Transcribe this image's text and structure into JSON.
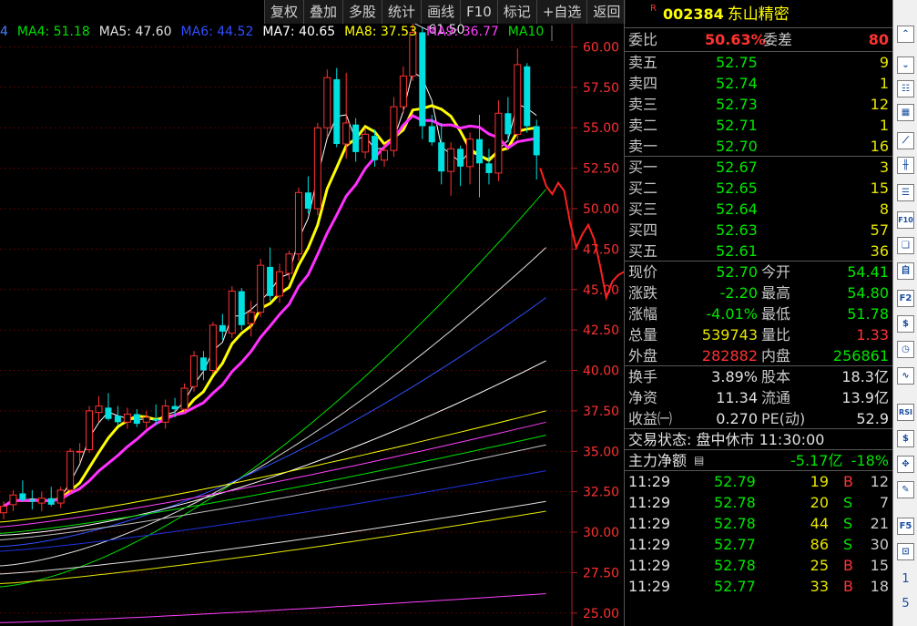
{
  "toolbar": [
    "复权",
    "叠加",
    "多股",
    "统计",
    "画线",
    "F10",
    "标记",
    "+自选",
    "返回"
  ],
  "ma_legend": [
    {
      "label": "4",
      "color": "#4080ff"
    },
    {
      "label": "MA4: 51.18",
      "color": "#00e000"
    },
    {
      "label": "MA5: 47.60",
      "color": "#e0e0e0"
    },
    {
      "label": "MA6: 44.52",
      "color": "#3050ff"
    },
    {
      "label": "MA7: 40.65",
      "color": "#ffffff"
    },
    {
      "label": "MA8: 37.53",
      "color": "#ffff00"
    },
    {
      "label": "MA9: 36.77",
      "color": "#ff40ff"
    },
    {
      "label": "MA10",
      "color": "#00e000"
    }
  ],
  "chart_data": {
    "type": "candlestick",
    "price_axis": [
      "60.00",
      "57.50",
      "55.00",
      "52.50",
      "50.00",
      "47.50",
      "45.00",
      "42.50",
      "40.00",
      "37.50",
      "35.00",
      "32.50",
      "30.00",
      "27.50",
      "25.00"
    ],
    "ylim": [
      24.2,
      62.9
    ],
    "high_annotation": "61.50",
    "candles": [
      {
        "o": 31.2,
        "h": 31.9,
        "l": 30.8,
        "c": 31.6
      },
      {
        "o": 31.7,
        "h": 32.6,
        "l": 31.3,
        "c": 32.3
      },
      {
        "o": 32.4,
        "h": 33.2,
        "l": 31.9,
        "c": 32.0
      },
      {
        "o": 32.0,
        "h": 32.6,
        "l": 31.4,
        "c": 31.9
      },
      {
        "o": 31.8,
        "h": 32.5,
        "l": 31.3,
        "c": 32.1
      },
      {
        "o": 32.1,
        "h": 32.8,
        "l": 31.6,
        "c": 31.7
      },
      {
        "o": 31.8,
        "h": 32.8,
        "l": 31.5,
        "c": 32.6
      },
      {
        "o": 32.6,
        "h": 35.2,
        "l": 32.4,
        "c": 35.0
      },
      {
        "o": 35.0,
        "h": 35.5,
        "l": 34.3,
        "c": 35.0
      },
      {
        "o": 35.1,
        "h": 37.8,
        "l": 34.9,
        "c": 37.5
      },
      {
        "o": 37.4,
        "h": 38.4,
        "l": 36.8,
        "c": 37.8
      },
      {
        "o": 37.7,
        "h": 38.6,
        "l": 36.9,
        "c": 37.0
      },
      {
        "o": 37.2,
        "h": 37.8,
        "l": 36.6,
        "c": 36.8
      },
      {
        "o": 36.8,
        "h": 37.7,
        "l": 36.4,
        "c": 37.3
      },
      {
        "o": 37.3,
        "h": 37.6,
        "l": 36.5,
        "c": 36.7
      },
      {
        "o": 36.8,
        "h": 37.5,
        "l": 36.4,
        "c": 37.1
      },
      {
        "o": 37.0,
        "h": 37.9,
        "l": 36.6,
        "c": 36.9
      },
      {
        "o": 36.8,
        "h": 38.2,
        "l": 36.4,
        "c": 37.8
      },
      {
        "o": 37.8,
        "h": 38.3,
        "l": 37.1,
        "c": 37.6
      },
      {
        "o": 37.6,
        "h": 39.2,
        "l": 37.4,
        "c": 38.9
      },
      {
        "o": 39.0,
        "h": 41.2,
        "l": 38.7,
        "c": 40.9
      },
      {
        "o": 40.8,
        "h": 41.2,
        "l": 39.4,
        "c": 40.0
      },
      {
        "o": 40.0,
        "h": 43.0,
        "l": 39.8,
        "c": 42.8
      },
      {
        "o": 42.8,
        "h": 43.5,
        "l": 41.9,
        "c": 42.4
      },
      {
        "o": 42.3,
        "h": 45.2,
        "l": 42.0,
        "c": 44.9
      },
      {
        "o": 44.9,
        "h": 45.1,
        "l": 42.5,
        "c": 42.8
      },
      {
        "o": 42.9,
        "h": 44.3,
        "l": 42.1,
        "c": 43.6
      },
      {
        "o": 43.6,
        "h": 46.9,
        "l": 43.3,
        "c": 46.5
      },
      {
        "o": 46.4,
        "h": 47.6,
        "l": 44.3,
        "c": 44.6
      },
      {
        "o": 44.6,
        "h": 46.6,
        "l": 44.2,
        "c": 46.1
      },
      {
        "o": 46.0,
        "h": 47.4,
        "l": 45.6,
        "c": 47.2
      },
      {
        "o": 47.2,
        "h": 51.3,
        "l": 46.8,
        "c": 51.0
      },
      {
        "o": 51.0,
        "h": 52.0,
        "l": 49.7,
        "c": 50.0
      },
      {
        "o": 50.0,
        "h": 55.3,
        "l": 49.6,
        "c": 55.0
      },
      {
        "o": 55.0,
        "h": 58.6,
        "l": 54.4,
        "c": 58.1
      },
      {
        "o": 58.0,
        "h": 58.7,
        "l": 53.8,
        "c": 54.0
      },
      {
        "o": 54.0,
        "h": 58.4,
        "l": 53.1,
        "c": 55.3
      },
      {
        "o": 55.2,
        "h": 55.6,
        "l": 52.9,
        "c": 53.5
      },
      {
        "o": 53.5,
        "h": 55.0,
        "l": 53.1,
        "c": 54.6
      },
      {
        "o": 54.5,
        "h": 54.9,
        "l": 52.6,
        "c": 53.0
      },
      {
        "o": 53.0,
        "h": 54.0,
        "l": 52.6,
        "c": 53.6
      },
      {
        "o": 53.6,
        "h": 56.9,
        "l": 53.2,
        "c": 56.3
      },
      {
        "o": 56.3,
        "h": 58.8,
        "l": 55.9,
        "c": 58.2
      },
      {
        "o": 58.2,
        "h": 61.5,
        "l": 57.9,
        "c": 60.9
      },
      {
        "o": 60.9,
        "h": 61.2,
        "l": 54.3,
        "c": 55.1
      },
      {
        "o": 55.1,
        "h": 55.8,
        "l": 53.9,
        "c": 54.1
      },
      {
        "o": 54.1,
        "h": 55.3,
        "l": 51.5,
        "c": 52.3
      },
      {
        "o": 52.3,
        "h": 54.1,
        "l": 50.8,
        "c": 53.7
      },
      {
        "o": 53.7,
        "h": 53.9,
        "l": 51.4,
        "c": 52.6
      },
      {
        "o": 52.6,
        "h": 54.7,
        "l": 51.5,
        "c": 54.3
      },
      {
        "o": 54.3,
        "h": 55.8,
        "l": 50.7,
        "c": 52.8
      },
      {
        "o": 52.8,
        "h": 53.7,
        "l": 51.5,
        "c": 52.2
      },
      {
        "o": 52.2,
        "h": 56.7,
        "l": 51.7,
        "c": 55.9
      },
      {
        "o": 55.9,
        "h": 56.9,
        "l": 54.1,
        "c": 54.6
      },
      {
        "o": 54.6,
        "h": 59.9,
        "l": 54.3,
        "c": 58.9
      },
      {
        "o": 58.8,
        "h": 59.0,
        "l": 54.7,
        "c": 55.1
      },
      {
        "o": 55.1,
        "h": 55.5,
        "l": 51.8,
        "c": 53.3
      }
    ],
    "ma_lines": [
      {
        "name": "MA4",
        "color": "#00e000",
        "width": 1,
        "ends": [
          26.6,
          51.2
        ]
      },
      {
        "name": "MA5",
        "color": "#e0e0e0",
        "width": 1,
        "ends": [
          27.9,
          47.6
        ]
      },
      {
        "name": "MA6",
        "color": "#3050ff",
        "width": 1,
        "ends": [
          29.1,
          44.5
        ]
      },
      {
        "name": "MA7",
        "color": "#ffffff",
        "width": 1,
        "ends": [
          29.8,
          40.6
        ]
      },
      {
        "name": "MA8",
        "color": "#ffff00",
        "width": 1,
        "ends": [
          30.6,
          37.5
        ]
      },
      {
        "name": "MA9",
        "color": "#ff40ff",
        "width": 1,
        "ends": [
          30.3,
          36.8
        ]
      },
      {
        "name": "MA10",
        "color": "#00e000",
        "width": 1,
        "ends": [
          29.9,
          36.0
        ]
      },
      {
        "name": "MA11",
        "color": "#c0c0c0",
        "width": 1,
        "ends": [
          29.5,
          35.4
        ]
      },
      {
        "name": "MA12",
        "color": "#2030e0",
        "width": 1,
        "ends": [
          28.8,
          33.8
        ]
      },
      {
        "name": "MA13",
        "color": "#e0e0e0",
        "width": 1,
        "ends": [
          27.4,
          31.9
        ]
      },
      {
        "name": "MA14",
        "color": "#e8e800",
        "width": 1,
        "ends": [
          26.8,
          31.3
        ]
      },
      {
        "name": "MA15",
        "color": "#ff40ff",
        "width": 1,
        "ends": [
          24.4,
          26.2
        ]
      }
    ],
    "intraday_tail": [
      52.5,
      51.4,
      50.9,
      51.6,
      51.1,
      49.1,
      47.6,
      48.4,
      49.0,
      48.1,
      46.4,
      44.5,
      45.5,
      45.9,
      46.1,
      46.2,
      44.3,
      42.0,
      40.0
    ]
  },
  "quote": {
    "r_mark": "R",
    "code": "002384",
    "name": "东山精密",
    "weibi_label": "委比",
    "weibi_value": "50.63%",
    "weicha_label": "委差",
    "weicha_value": "80",
    "sells": [
      {
        "label": "卖五",
        "price": "52.75",
        "vol": "9"
      },
      {
        "label": "卖四",
        "price": "52.74",
        "vol": "1"
      },
      {
        "label": "卖三",
        "price": "52.73",
        "vol": "12"
      },
      {
        "label": "卖二",
        "price": "52.71",
        "vol": "1"
      },
      {
        "label": "卖一",
        "price": "52.70",
        "vol": "16"
      }
    ],
    "buys": [
      {
        "label": "买一",
        "price": "52.67",
        "vol": "3"
      },
      {
        "label": "买二",
        "price": "52.65",
        "vol": "15"
      },
      {
        "label": "买三",
        "price": "52.64",
        "vol": "8"
      },
      {
        "label": "买四",
        "price": "52.63",
        "vol": "57"
      },
      {
        "label": "买五",
        "price": "52.61",
        "vol": "36"
      }
    ],
    "stats": [
      {
        "l1": "现价",
        "v1": "52.70",
        "c1": "green",
        "l2": "今开",
        "v2": "54.41",
        "c2": "green"
      },
      {
        "l1": "涨跌",
        "v1": "-2.20",
        "c1": "green",
        "l2": "最高",
        "v2": "54.80",
        "c2": "green"
      },
      {
        "l1": "涨幅",
        "v1": "-4.01%",
        "c1": "green",
        "l2": "最低",
        "v2": "51.78",
        "c2": "green"
      },
      {
        "l1": "总量",
        "v1": "539743",
        "c1": "yel",
        "l2": "量比",
        "v2": "1.33",
        "c2": "red"
      },
      {
        "l1": "外盘",
        "v1": "282882",
        "c1": "red",
        "l2": "内盘",
        "v2": "256861",
        "c2": "green"
      }
    ],
    "fundamentals": [
      {
        "l1": "换手",
        "v1": "3.89%",
        "l2": "股本",
        "v2": "18.3亿"
      },
      {
        "l1": "净资",
        "v1": "11.34",
        "l2": "流通",
        "v2": "13.9亿"
      },
      {
        "l1": "收益㈠",
        "v1": "0.270",
        "l2": "PE(动)",
        "v2": "52.9"
      }
    ],
    "trade_status": "交易状态: 盘中休市 11:30:00",
    "main_net_label": "主力净额",
    "main_net_value": "-5.17亿",
    "main_net_pct": "-18%",
    "ticks": [
      {
        "time": "11:29",
        "price": "52.79",
        "vol": "19",
        "side": "B",
        "n": "12"
      },
      {
        "time": "11:29",
        "price": "52.78",
        "vol": "20",
        "side": "S",
        "n": "7"
      },
      {
        "time": "11:29",
        "price": "52.78",
        "vol": "44",
        "side": "S",
        "n": "21"
      },
      {
        "time": "11:29",
        "price": "52.77",
        "vol": "86",
        "side": "S",
        "n": "30"
      },
      {
        "time": "11:29",
        "price": "52.78",
        "vol": "25",
        "side": "B",
        "n": "15"
      },
      {
        "time": "11:29",
        "price": "52.77",
        "vol": "33",
        "side": "B",
        "n": "18"
      }
    ]
  },
  "sidebar": {
    "icons": [
      {
        "name": "scroll-up-icon",
        "glyph": "⌃"
      },
      {
        "name": "scroll-down-icon",
        "glyph": "⌄"
      },
      {
        "name": "report-icon",
        "glyph": "☷"
      },
      {
        "name": "table-icon",
        "glyph": "▦"
      },
      {
        "name": "line-chart-icon",
        "glyph": "⟋"
      },
      {
        "name": "kline-icon",
        "glyph": "╫"
      },
      {
        "name": "list-icon",
        "glyph": "☰"
      },
      {
        "name": "f10-icon",
        "glyph": "F10"
      },
      {
        "name": "hot-icon",
        "glyph": "❏"
      },
      {
        "name": "self-select-icon",
        "glyph": "自"
      },
      {
        "name": "f2-icon",
        "glyph": "F2"
      },
      {
        "name": "dollar-icon",
        "glyph": "$"
      },
      {
        "name": "clock-icon",
        "glyph": "◷"
      },
      {
        "name": "wave-icon",
        "glyph": "∿"
      },
      {
        "name": "rsi-icon",
        "glyph": "RSI"
      },
      {
        "name": "money-icon",
        "glyph": "$"
      },
      {
        "name": "move-icon",
        "glyph": "✥"
      },
      {
        "name": "pen-icon",
        "glyph": "✎"
      },
      {
        "name": "f5-icon",
        "glyph": "F5"
      },
      {
        "name": "zoom-icon",
        "glyph": "⊡"
      }
    ],
    "page_numbers": [
      "1",
      "5"
    ]
  }
}
